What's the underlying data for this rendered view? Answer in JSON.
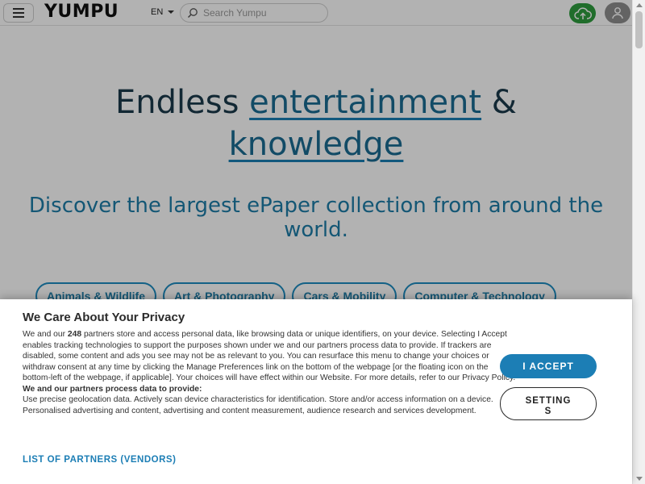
{
  "header": {
    "logo": "YUMPU",
    "language": "EN",
    "search": {
      "placeholder": "Search Yumpu",
      "value": ""
    },
    "icons": [
      "menu-icon",
      "search-icon",
      "cloud-upload-icon",
      "user-icon"
    ],
    "upload_color": "#2e9d3e"
  },
  "hero": {
    "title_part1": "Endless ",
    "title_highlight1": "entertainment",
    "title_part2": " &",
    "title_highlight2": "knowledge",
    "subtitle": "Discover the largest ePaper collection from around the world."
  },
  "categories": [
    "Animals & Wildlife",
    "Art & Photography",
    "Cars & Mobility",
    "Computer & Technology"
  ],
  "consent": {
    "title": "We Care About Your Privacy",
    "intro_before_count": "We and our ",
    "partner_count": "248",
    "intro_after_count": " partners store and access personal data, like browsing data or unique identifiers, on your device. Selecting I Accept enables tracking technologies to support the purposes shown under we and our partners process data to provide. If trackers are disabled, some content and ads you see may not be as relevant to you. You can resurface this menu to change your choices or withdraw consent at any time by clicking the Manage Preferences link on the bottom of the webpage [or the floating icon on the bottom-left of the webpage, if applicable]. Your choices will have effect within our Website. For more details, refer to our Privacy Policy.",
    "process_heading": "We and our partners process data to provide:",
    "purposes": "Use precise geolocation data. Actively scan device characteristics for identification. Store and/or access information on a device. Personalised advertising and content, advertising and content measurement, audience research and services development.",
    "partners_link": "LIST OF PARTNERS (VENDORS)",
    "accept_label": "I ACCEPT",
    "settings_label": "SETTINGS",
    "accent_color": "#1c7eb5"
  }
}
